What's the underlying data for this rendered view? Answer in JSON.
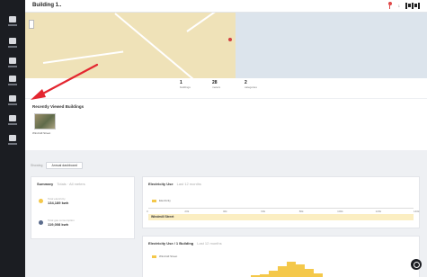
{
  "header": {
    "title": "Building 1..",
    "mid_label": "1"
  },
  "sidebar": {
    "items": [
      {
        "icon": "home-icon",
        "label": ""
      },
      {
        "icon": "grid-icon",
        "label": ""
      },
      {
        "icon": "chart-icon",
        "label": ""
      },
      {
        "icon": "table-icon",
        "label": ""
      },
      {
        "icon": "settings-icon",
        "label": ""
      },
      {
        "icon": "document-icon",
        "label": ""
      },
      {
        "icon": "user-icon",
        "label": ""
      }
    ]
  },
  "stats": [
    {
      "value": "1",
      "label": "buildings"
    },
    {
      "value": "28",
      "label": "meters"
    },
    {
      "value": "2",
      "label": "categories"
    }
  ],
  "recent": {
    "title": "Recently Viewed Buildings",
    "item_caption": "Windmill Street"
  },
  "filter": {
    "label": "Showing",
    "value": "Annual dashboard"
  },
  "summary": {
    "title": "Summary",
    "subtitle": "Totals · All meters",
    "rows": [
      {
        "label": "Total electricity",
        "value": "134,189 kwh",
        "color": "#f4c84a"
      },
      {
        "label": "Total gas consumption",
        "value": "119,008 kwh",
        "color": "#5b6c8c"
      }
    ]
  },
  "electricity_use": {
    "title": "Electricity Use",
    "subtitle": "Last 12 months",
    "legend": "Electricity",
    "bar_label": "Windmill Street",
    "ticks": [
      "0",
      "20k",
      "40k",
      "60k",
      "80k",
      "100k",
      "120k",
      "140k"
    ]
  },
  "electricity_by_building": {
    "title": "Electricity Use / 1 Building",
    "subtitle": "Last 12 months",
    "legend": "Windmill Street",
    "chart_data": {
      "type": "bar",
      "series": [
        {
          "name": "Windmill Street",
          "values": [
            2,
            3,
            6,
            10,
            14,
            12,
            8,
            4
          ]
        }
      ]
    }
  },
  "colors": {
    "sidebar": "#1b1d22",
    "accent": "#f4c84a",
    "map_land": "#efe2b8",
    "map_water": "#dce4ec",
    "pin": "#d24040"
  }
}
